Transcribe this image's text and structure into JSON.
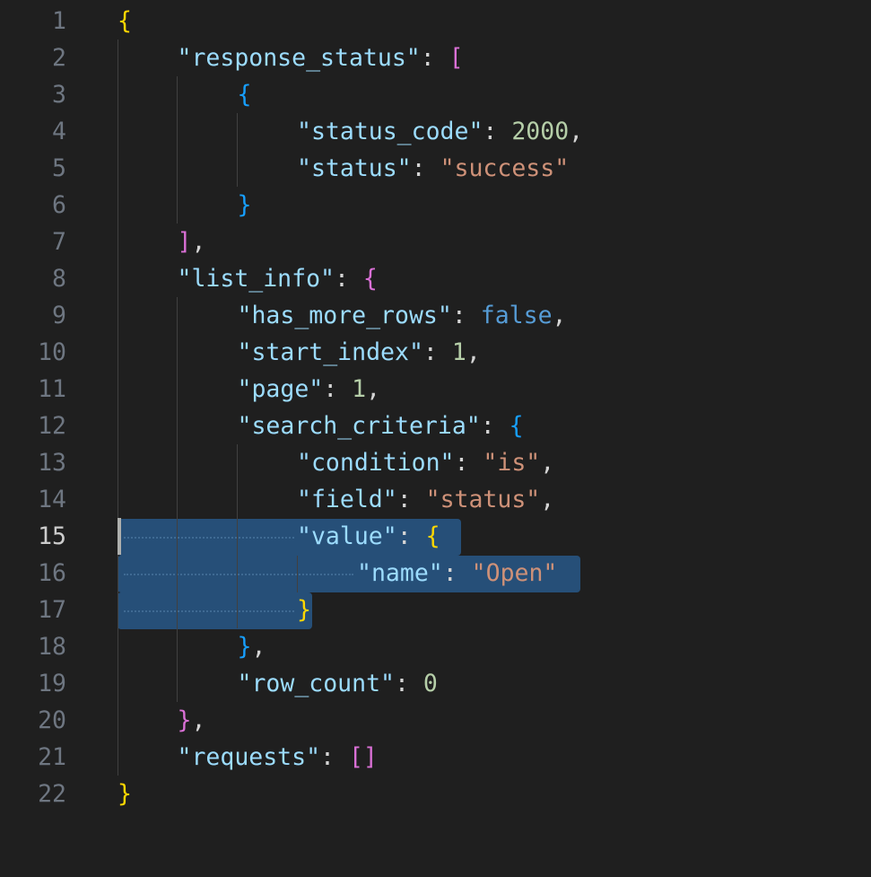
{
  "editor": {
    "line_numbers": [
      "1",
      "2",
      "3",
      "4",
      "5",
      "6",
      "7",
      "8",
      "9",
      "10",
      "11",
      "12",
      "13",
      "14",
      "15",
      "16",
      "17",
      "18",
      "19",
      "20",
      "21",
      "22"
    ],
    "active_line": "15"
  },
  "code": {
    "l1_open": "{",
    "l2_key": "\"response_status\"",
    "l2_colon": ": ",
    "l2_open": "[",
    "l3_open": "{",
    "l4_key": "\"status_code\"",
    "l4_colon": ": ",
    "l4_val": "2000",
    "l4_comma": ",",
    "l5_key": "\"status\"",
    "l5_colon": ": ",
    "l5_val": "\"success\"",
    "l6_close": "}",
    "l7_close": "]",
    "l7_comma": ",",
    "l8_key": "\"list_info\"",
    "l8_colon": ": ",
    "l8_open": "{",
    "l9_key": "\"has_more_rows\"",
    "l9_colon": ": ",
    "l9_val": "false",
    "l9_comma": ",",
    "l10_key": "\"start_index\"",
    "l10_colon": ": ",
    "l10_val": "1",
    "l10_comma": ",",
    "l11_key": "\"page\"",
    "l11_colon": ": ",
    "l11_val": "1",
    "l11_comma": ",",
    "l12_key": "\"search_criteria\"",
    "l12_colon": ": ",
    "l12_open": "{",
    "l13_key": "\"condition\"",
    "l13_colon": ": ",
    "l13_val": "\"is\"",
    "l13_comma": ",",
    "l14_key": "\"field\"",
    "l14_colon": ": ",
    "l14_val": "\"status\"",
    "l14_comma": ",",
    "l15_key": "\"value\"",
    "l15_colon": ": ",
    "l15_open": "{",
    "l16_key": "\"name\"",
    "l16_colon": ": ",
    "l16_val": "\"Open\"",
    "l17_close": "}",
    "l18_close": "}",
    "l18_comma": ",",
    "l19_key": "\"row_count\"",
    "l19_colon": ": ",
    "l19_val": "0",
    "l20_close": "}",
    "l20_comma": ",",
    "l21_key": "\"requests\"",
    "l21_colon": ": ",
    "l21_val": "[]",
    "l22_close": "}"
  },
  "theme": {
    "background": "#1f1f1f",
    "selection": "#264f78",
    "key": "#9cdcfe",
    "string": "#ce9178",
    "number": "#b5cea8",
    "keyword": "#569cd6",
    "bracket_level1": "#ffd700",
    "bracket_level2": "#da70d6",
    "bracket_level3": "#179fff"
  }
}
